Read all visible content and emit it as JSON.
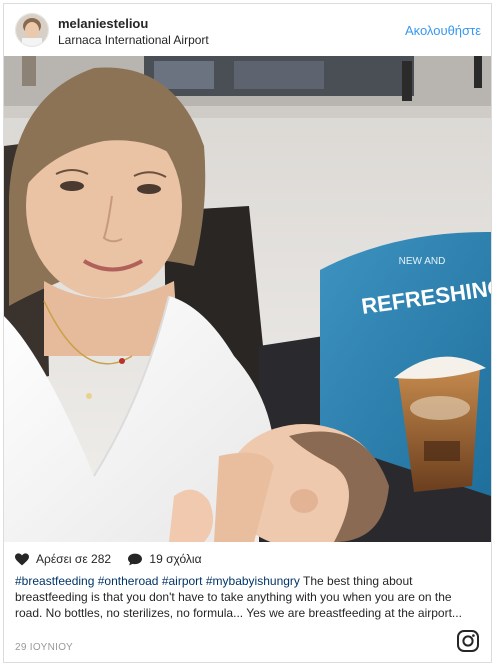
{
  "post": {
    "username": "melaniesteliou",
    "location": "Larnaca International Airport",
    "follow_label": "Ακολουθήστε",
    "photo_sign_small": "NEW AND",
    "photo_sign_big": "REFRESHING",
    "likes_label": "Αρέσει σε 282",
    "comments_label": "19 σχόλια",
    "hashtags": [
      "#breastfeeding",
      "#ontheroad",
      "#airport",
      "#mybabyishungry"
    ],
    "caption_text": "The best thing about breastfeeding is that you don't have to take anything with you when you are on the road. No bottles, no sterilizes, no formula... Yes we are breastfeeding at the airport...",
    "date": "29 ΙΟΥΝΙΟΥ"
  },
  "colors": {
    "link_blue": "#3897f0",
    "hashtag_blue": "#003569",
    "muted_gray": "#999999",
    "border": "#dcdcdc"
  },
  "icons": {
    "heart": "heart-icon",
    "comment": "comment-icon",
    "instagram": "instagram-logo-icon"
  }
}
